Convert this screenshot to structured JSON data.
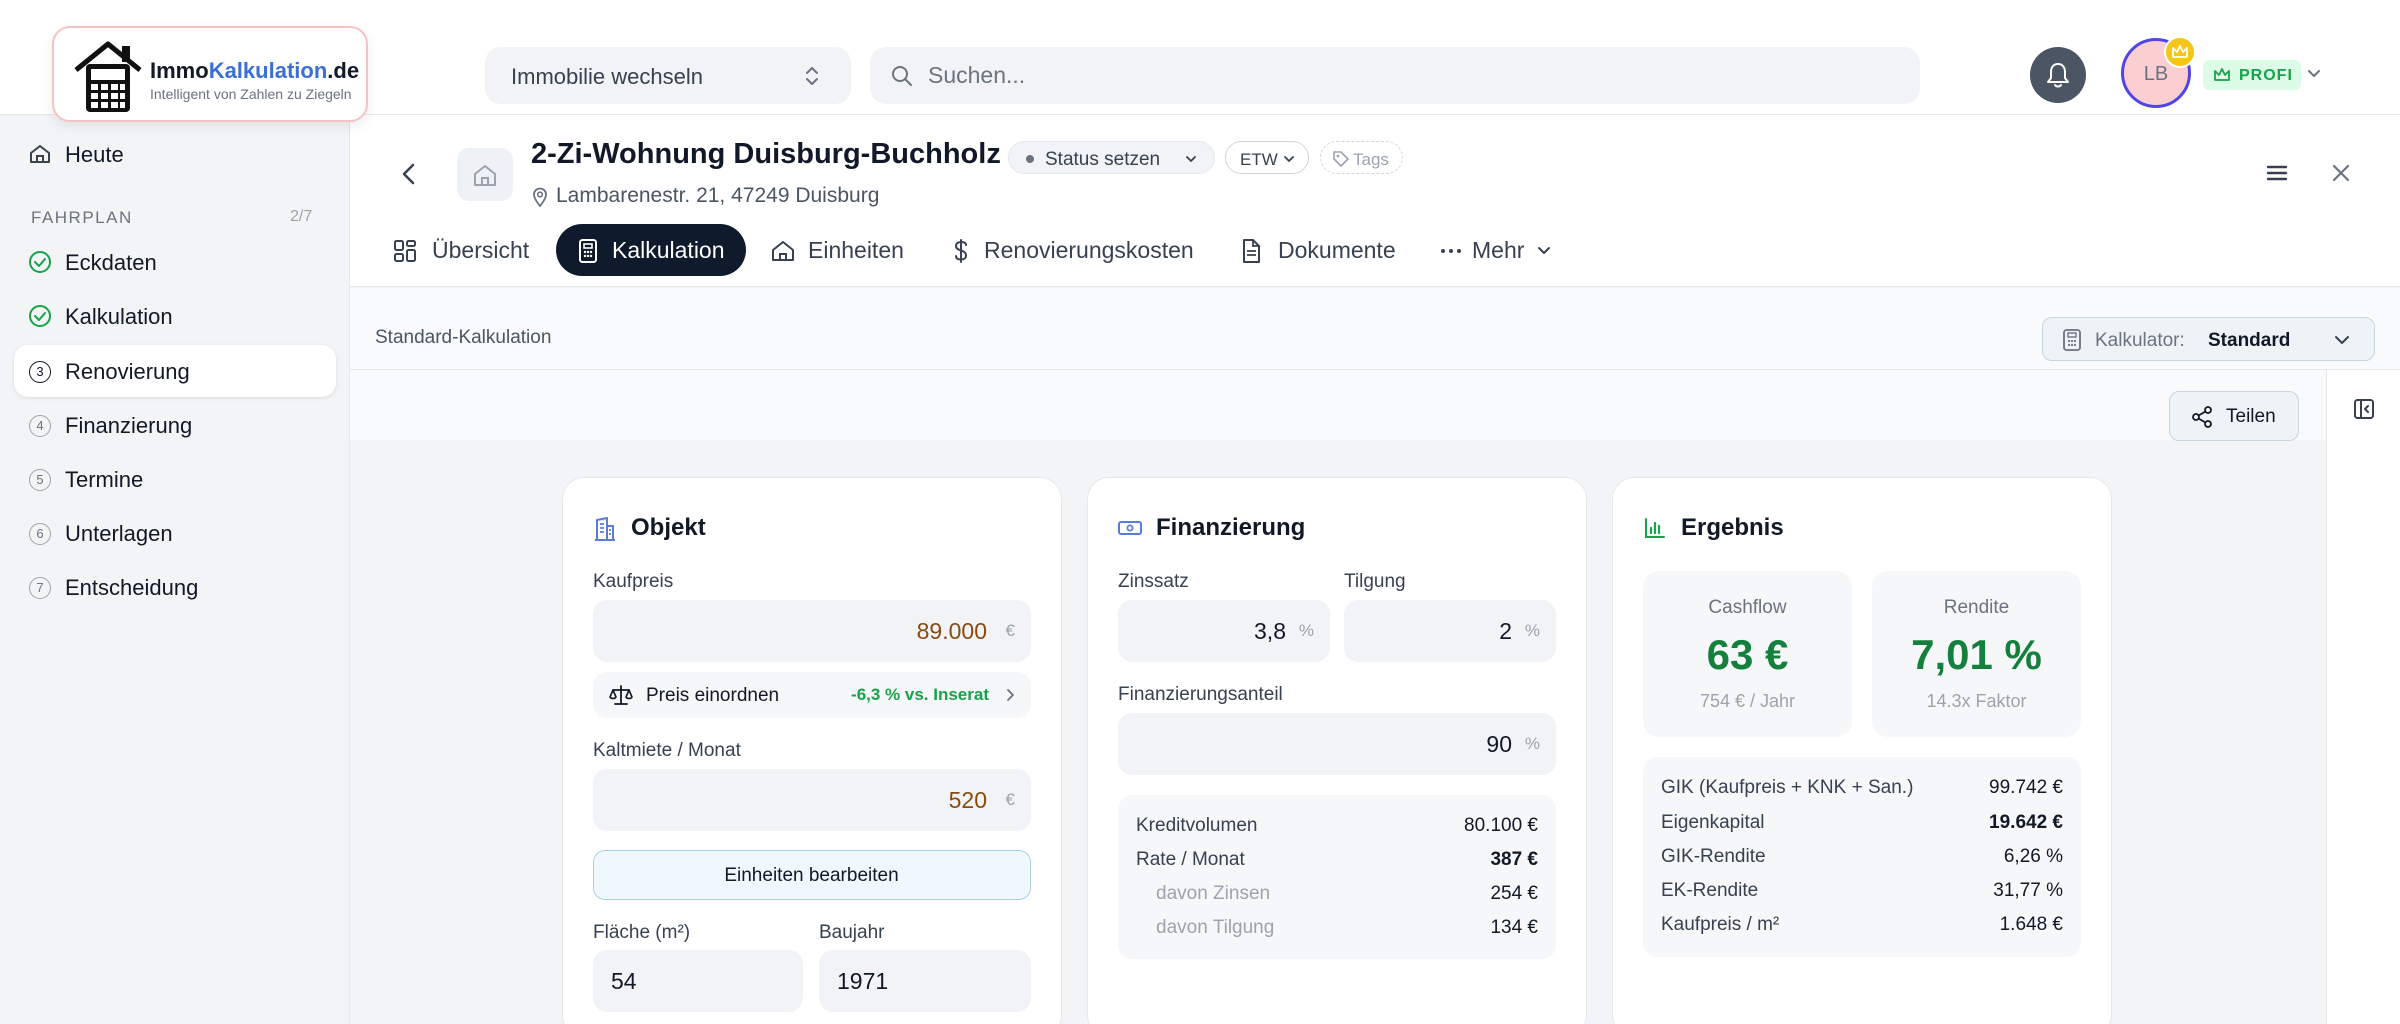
{
  "topbar": {
    "logo_name_part1": "Immo",
    "logo_name_part2": "Kalkulation",
    "logo_name_part3": ".de",
    "logo_tagline": "Intelligent von Zahlen zu Ziegeln",
    "property_switch_label": "Immobilie wechseln",
    "search_placeholder": "Suchen...",
    "avatar_initials": "LB",
    "plan_label": "PROFI"
  },
  "sidebar": {
    "today_label": "Heute",
    "section_label": "FAHRPLAN",
    "section_progress": "2/7",
    "steps": [
      {
        "num": "",
        "label": "Eckdaten",
        "state": "done"
      },
      {
        "num": "",
        "label": "Kalkulation",
        "state": "done"
      },
      {
        "num": "3",
        "label": "Renovierung",
        "state": "active"
      },
      {
        "num": "4",
        "label": "Finanzierung",
        "state": "todo"
      },
      {
        "num": "5",
        "label": "Termine",
        "state": "todo"
      },
      {
        "num": "6",
        "label": "Unterlagen",
        "state": "todo"
      },
      {
        "num": "7",
        "label": "Entscheidung",
        "state": "todo"
      }
    ]
  },
  "property": {
    "title": "2-Zi-Wohnung Duisburg-Buchholz",
    "address": "Lambarenestr. 21, 47249 Duisburg",
    "status_label": "Status setzen",
    "type_label": "ETW",
    "tags_label": "Tags"
  },
  "tabs": [
    {
      "label": "Übersicht",
      "active": false
    },
    {
      "label": "Kalkulation",
      "active": true
    },
    {
      "label": "Einheiten",
      "active": false
    },
    {
      "label": "Renovierungskosten",
      "active": false
    },
    {
      "label": "Dokumente",
      "active": false
    },
    {
      "label": "Mehr",
      "active": false
    }
  ],
  "subheader": {
    "title": "Standard-Kalkulation",
    "calculator_key": "Kalkulator:",
    "calculator_value": "Standard"
  },
  "share_label": "Teilen",
  "objekt": {
    "title": "Objekt",
    "kaufpreis_label": "Kaufpreis",
    "kaufpreis_value": "89.000",
    "currency": "€",
    "price_rank_label": "Preis einordnen",
    "price_rank_delta": "-6,3 % vs. Inserat",
    "kaltmiete_label": "Kaltmiete / Monat",
    "kaltmiete_value": "520",
    "units_button": "Einheiten bearbeiten",
    "flaeche_label": "Fläche (m²)",
    "flaeche_value": "54",
    "baujahr_label": "Baujahr",
    "baujahr_value": "1971"
  },
  "finanzierung": {
    "title": "Finanzierung",
    "zinssatz_label": "Zinssatz",
    "zinssatz_value": "3,8",
    "tilgung_label": "Tilgung",
    "tilgung_value": "2",
    "anteil_label": "Finanzierungsanteil",
    "anteil_value": "90",
    "percent": "%",
    "rows": [
      {
        "label": "Kreditvolumen",
        "value": "80.100 €"
      },
      {
        "label": "Rate / Monat",
        "value": "387 €"
      },
      {
        "label": "davon Zinsen",
        "value": "254 €"
      },
      {
        "label": "davon Tilgung",
        "value": "134 €"
      }
    ]
  },
  "ergebnis": {
    "title": "Ergebnis",
    "cashflow_label": "Cashflow",
    "cashflow_value": "63 €",
    "cashflow_sub": "754 € / Jahr",
    "rendite_label": "Rendite",
    "rendite_value": "7,01 %",
    "rendite_sub": "14.3x Faktor",
    "rows": [
      {
        "label": "GIK (Kaufpreis + KNK + San.)",
        "value": "99.742 €"
      },
      {
        "label": "Eigenkapital",
        "value": "19.642 €"
      },
      {
        "label": "GIK-Rendite",
        "value": "6,26 %"
      },
      {
        "label": "EK-Rendite",
        "value": "31,77 %"
      },
      {
        "label": "Kaufpreis / m²",
        "value": "1.648 €"
      }
    ]
  },
  "colors": {
    "accent_dark": "#0f1b2d",
    "positive_green": "#15803d",
    "input_brown": "#8a4b10",
    "brand_blue": "#3b6fd8"
  }
}
